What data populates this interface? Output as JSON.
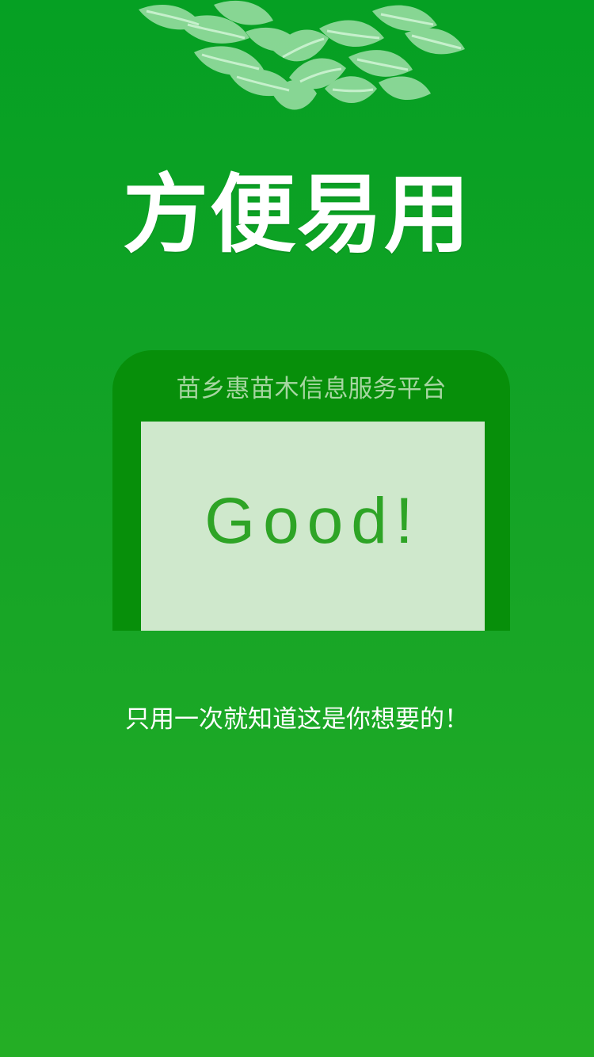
{
  "colors": {
    "background_top": "#05A023",
    "background_bottom": "#24AE25",
    "card_frame": "#078F0A",
    "card_screen": "#CFE8CC",
    "headline": "#FFFFFF",
    "good_text": "#2EA426",
    "leaf": "#8ED99A"
  },
  "hero": {
    "decor_icon": "leaf-cluster-icon",
    "title": "方便易用"
  },
  "phone_card": {
    "title": "苗乡惠苗木信息服务平台",
    "screen_text": "Good!"
  },
  "footer": {
    "tagline": "只用一次就知道这是你想要的！"
  }
}
